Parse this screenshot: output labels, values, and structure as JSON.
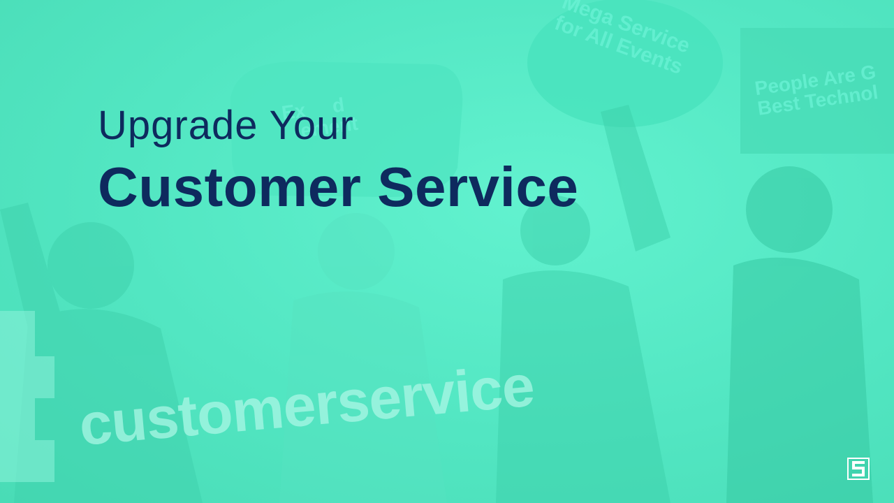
{
  "headline": {
    "line1": "Upgrade Your",
    "line2": "Customer Service"
  },
  "signs": {
    "sign_top_right": "Mega Service\nfor All Events",
    "sign_far_right": "People Are G\nBest Technol",
    "sign_left": "Ex     d\n   ement"
  },
  "watermark": "customerservice",
  "logo_icon": "s-logo-icon",
  "colors": {
    "background": "#5ef0cc",
    "headline": "#0e2a5e",
    "watermark": "#aef8e7"
  }
}
